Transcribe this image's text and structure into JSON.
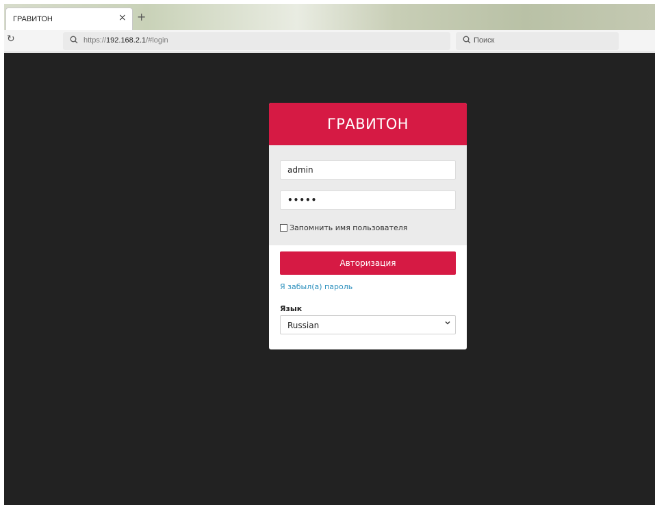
{
  "browser": {
    "tab_title": "ГРАВИТОН",
    "tab_close": "×",
    "new_tab": "+",
    "reload_icon": "↻",
    "url_prefix": "https://",
    "url_host": "192.168.2.1",
    "url_suffix": "/#login",
    "search_placeholder": "Поиск"
  },
  "login": {
    "brand": "ГРАВИТОН",
    "username_value": "admin",
    "password_value": "•••••",
    "remember_label": "Запомнить имя пользователя",
    "submit_label": "Авторизация",
    "forgot_label": "Я забыл(а) пароль",
    "language_label": "Язык",
    "language_selected": "Russian"
  },
  "colors": {
    "accent": "#d61a44",
    "page_background": "#222222",
    "link": "#2a8fbd"
  }
}
